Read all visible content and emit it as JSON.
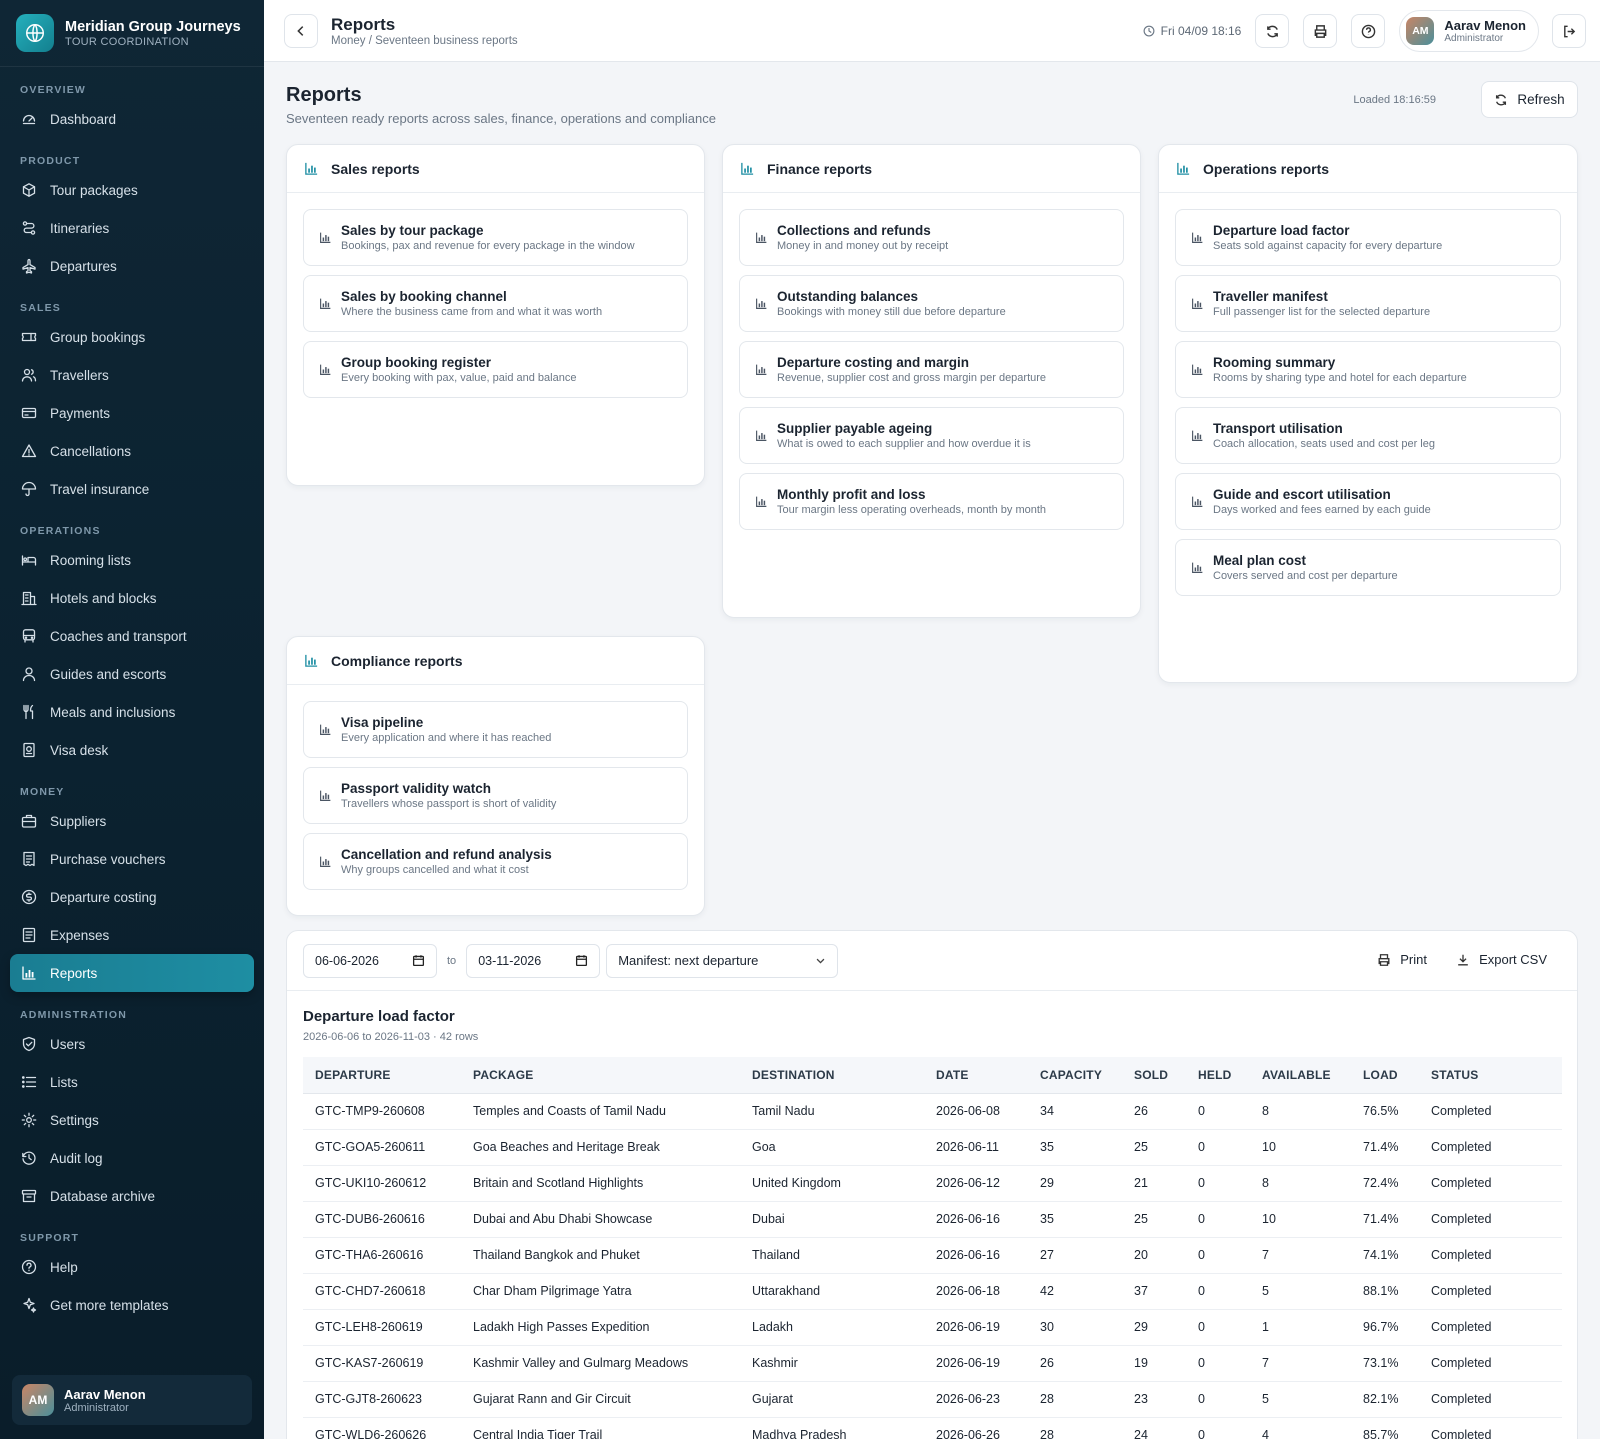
{
  "brand": {
    "title": "Meridian Group Journeys",
    "subtitle": "TOUR COORDINATION"
  },
  "nav": [
    {
      "section": "OVERVIEW",
      "items": [
        {
          "label": "Dashboard",
          "icon": "dashboard-icon"
        }
      ]
    },
    {
      "section": "PRODUCT",
      "items": [
        {
          "label": "Tour packages",
          "icon": "package-icon"
        },
        {
          "label": "Itineraries",
          "icon": "route-icon"
        },
        {
          "label": "Departures",
          "icon": "plane-icon"
        }
      ]
    },
    {
      "section": "SALES",
      "items": [
        {
          "label": "Group bookings",
          "icon": "ticket-icon"
        },
        {
          "label": "Travellers",
          "icon": "users-icon"
        },
        {
          "label": "Payments",
          "icon": "card-icon"
        },
        {
          "label": "Cancellations",
          "icon": "warning-icon"
        },
        {
          "label": "Travel insurance",
          "icon": "umbrella-icon"
        }
      ]
    },
    {
      "section": "OPERATIONS",
      "items": [
        {
          "label": "Rooming lists",
          "icon": "bed-icon"
        },
        {
          "label": "Hotels and blocks",
          "icon": "building-icon"
        },
        {
          "label": "Coaches and transport",
          "icon": "bus-icon"
        },
        {
          "label": "Guides and escorts",
          "icon": "user-icon"
        },
        {
          "label": "Meals and inclusions",
          "icon": "utensils-icon"
        },
        {
          "label": "Visa desk",
          "icon": "passport-icon"
        }
      ]
    },
    {
      "section": "MONEY",
      "items": [
        {
          "label": "Suppliers",
          "icon": "briefcase-icon"
        },
        {
          "label": "Purchase vouchers",
          "icon": "receipt-icon"
        },
        {
          "label": "Departure costing",
          "icon": "coin-icon"
        },
        {
          "label": "Expenses",
          "icon": "notes-icon"
        },
        {
          "label": "Reports",
          "icon": "chart-icon",
          "active": true
        }
      ]
    },
    {
      "section": "ADMINISTRATION",
      "items": [
        {
          "label": "Users",
          "icon": "shield-icon"
        },
        {
          "label": "Lists",
          "icon": "list-icon"
        },
        {
          "label": "Settings",
          "icon": "gear-icon"
        },
        {
          "label": "Audit log",
          "icon": "history-icon"
        },
        {
          "label": "Database archive",
          "icon": "archive-icon"
        }
      ]
    },
    {
      "section": "SUPPORT",
      "items": [
        {
          "label": "Help",
          "icon": "help-icon"
        },
        {
          "label": "Get more templates",
          "icon": "sparkle-icon"
        }
      ]
    }
  ],
  "side_user": {
    "initials": "AM",
    "name": "Aarav Menon",
    "role": "Administrator"
  },
  "topbar": {
    "title": "Reports",
    "breadcrumb": "Money / Seventeen business reports",
    "time": "Fri 04/09 18:16",
    "user": {
      "initials": "AM",
      "name": "Aarav Menon",
      "role": "Administrator"
    }
  },
  "page": {
    "title": "Reports",
    "subtitle": "Seventeen ready reports across sales, finance, operations and compliance",
    "loaded": "Loaded 18:16:59",
    "refresh_label": "Refresh"
  },
  "groups": {
    "sales": {
      "title": "Sales reports",
      "items": [
        {
          "title": "Sales by tour package",
          "desc": "Bookings, pax and revenue for every package in the window"
        },
        {
          "title": "Sales by booking channel",
          "desc": "Where the business came from and what it was worth"
        },
        {
          "title": "Group booking register",
          "desc": "Every booking with pax, value, paid and balance"
        }
      ]
    },
    "finance": {
      "title": "Finance reports",
      "items": [
        {
          "title": "Collections and refunds",
          "desc": "Money in and money out by receipt"
        },
        {
          "title": "Outstanding balances",
          "desc": "Bookings with money still due before departure"
        },
        {
          "title": "Departure costing and margin",
          "desc": "Revenue, supplier cost and gross margin per departure"
        },
        {
          "title": "Supplier payable ageing",
          "desc": "What is owed to each supplier and how overdue it is"
        },
        {
          "title": "Monthly profit and loss",
          "desc": "Tour margin less operating overheads, month by month"
        }
      ]
    },
    "operations": {
      "title": "Operations reports",
      "items": [
        {
          "title": "Departure load factor",
          "desc": "Seats sold against capacity for every departure"
        },
        {
          "title": "Traveller manifest",
          "desc": "Full passenger list for the selected departure"
        },
        {
          "title": "Rooming summary",
          "desc": "Rooms by sharing type and hotel for each departure"
        },
        {
          "title": "Transport utilisation",
          "desc": "Coach allocation, seats used and cost per leg"
        },
        {
          "title": "Guide and escort utilisation",
          "desc": "Days worked and fees earned by each guide"
        },
        {
          "title": "Meal plan cost",
          "desc": "Covers served and cost per departure"
        }
      ]
    },
    "compliance": {
      "title": "Compliance reports",
      "items": [
        {
          "title": "Visa pipeline",
          "desc": "Every application and where it has reached"
        },
        {
          "title": "Passport validity watch",
          "desc": "Travellers whose passport is short of validity"
        },
        {
          "title": "Cancellation and refund analysis",
          "desc": "Why groups cancelled and what it cost"
        }
      ]
    }
  },
  "filters": {
    "from": "06-06-2026",
    "to_label": "to",
    "to": "03-11-2026",
    "select": "Manifest: next departure",
    "print_label": "Print",
    "export_label": "Export CSV"
  },
  "table": {
    "title": "Departure load factor",
    "subtitle": "2026-06-06 to 2026-11-03 · 42 rows",
    "columns": [
      "DEPARTURE",
      "PACKAGE",
      "DESTINATION",
      "DATE",
      "CAPACITY",
      "SOLD",
      "HELD",
      "AVAILABLE",
      "LOAD",
      "STATUS"
    ],
    "rows": [
      [
        "GTC-TMP9-260608",
        "Temples and Coasts of Tamil Nadu",
        "Tamil Nadu",
        "2026-06-08",
        "34",
        "26",
        "0",
        "8",
        "76.5%",
        "Completed"
      ],
      [
        "GTC-GOA5-260611",
        "Goa Beaches and Heritage Break",
        "Goa",
        "2026-06-11",
        "35",
        "25",
        "0",
        "10",
        "71.4%",
        "Completed"
      ],
      [
        "GTC-UKI10-260612",
        "Britain and Scotland Highlights",
        "United Kingdom",
        "2026-06-12",
        "29",
        "21",
        "0",
        "8",
        "72.4%",
        "Completed"
      ],
      [
        "GTC-DUB6-260616",
        "Dubai and Abu Dhabi Showcase",
        "Dubai",
        "2026-06-16",
        "35",
        "25",
        "0",
        "10",
        "71.4%",
        "Completed"
      ],
      [
        "GTC-THA6-260616",
        "Thailand Bangkok and Phuket",
        "Thailand",
        "2026-06-16",
        "27",
        "20",
        "0",
        "7",
        "74.1%",
        "Completed"
      ],
      [
        "GTC-CHD7-260618",
        "Char Dham Pilgrimage Yatra",
        "Uttarakhand",
        "2026-06-18",
        "42",
        "37",
        "0",
        "5",
        "88.1%",
        "Completed"
      ],
      [
        "GTC-LEH8-260619",
        "Ladakh High Passes Expedition",
        "Ladakh",
        "2026-06-19",
        "30",
        "29",
        "0",
        "1",
        "96.7%",
        "Completed"
      ],
      [
        "GTC-KAS7-260619",
        "Kashmir Valley and Gulmarg Meadows",
        "Kashmir",
        "2026-06-19",
        "26",
        "19",
        "0",
        "7",
        "73.1%",
        "Completed"
      ],
      [
        "GTC-GJT8-260623",
        "Gujarat Rann and Gir Circuit",
        "Gujarat",
        "2026-06-23",
        "28",
        "23",
        "0",
        "5",
        "82.1%",
        "Completed"
      ],
      [
        "GTC-WLD6-260626",
        "Central India Tiger Trail",
        "Madhya Pradesh",
        "2026-06-26",
        "28",
        "24",
        "0",
        "4",
        "85.7%",
        "Completed"
      ]
    ]
  },
  "colors": {
    "accent": "#1e8ea3",
    "sidebar": "#0f2635"
  }
}
